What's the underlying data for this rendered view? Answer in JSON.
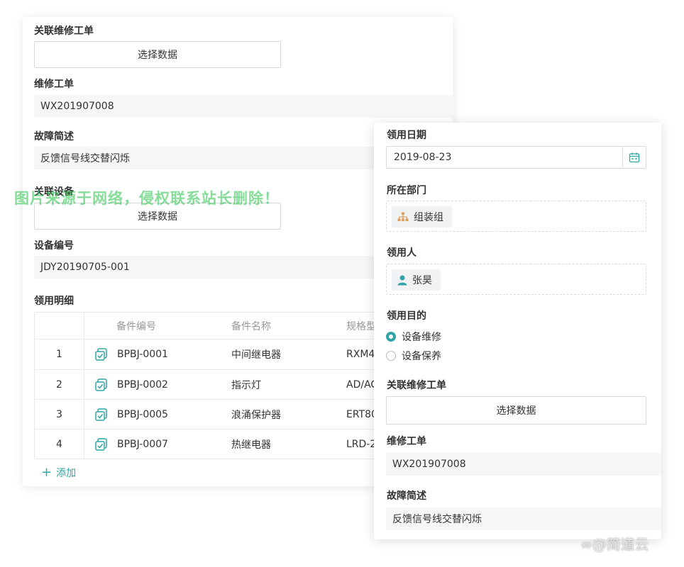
{
  "back_form": {
    "related_work_order_label": "关联维修工单",
    "select_data_label": "选择数据",
    "work_order_label": "维修工单",
    "work_order_value": "WX201907008",
    "fault_label": "故障简述",
    "fault_value": "反馈信号线交替闪烁",
    "related_device_label": "关联设备",
    "device_select_label": "选择数据",
    "device_no_label": "设备编号",
    "device_no_value": "JDY20190705-001",
    "detail_label": "领用明细",
    "table": {
      "headers": [
        "备件编号",
        "备件名称",
        "规格型"
      ],
      "rows": [
        {
          "index": "1",
          "code": "BPBJ-0001",
          "name": "中间继电器",
          "spec": "RXM4"
        },
        {
          "index": "2",
          "code": "BPBJ-0002",
          "name": "指示灯",
          "spec": "AD/AC"
        },
        {
          "index": "3",
          "code": "BPBJ-0005",
          "name": "浪涌保护器",
          "spec": "ERT80"
        },
        {
          "index": "4",
          "code": "BPBJ-0007",
          "name": "热继电器",
          "spec": "LRD-2"
        }
      ]
    },
    "add_label": "添加"
  },
  "front_form": {
    "date_label": "领用日期",
    "date_value": "2019-08-23",
    "dept_label": "所在部门",
    "dept_value": "组装组",
    "person_label": "领用人",
    "person_value": "张昊",
    "purpose_label": "领用目的",
    "purpose_options": [
      {
        "label": "设备维修",
        "checked": true
      },
      {
        "label": "设备保养",
        "checked": false
      }
    ],
    "related_work_order_label": "关联维修工单",
    "select_data_label": "选择数据",
    "work_order_label": "维修工单",
    "work_order_value": "WX201907008",
    "fault_label": "故障简述",
    "fault_value": "反馈信号线交替闪烁"
  },
  "watermark": "图片来源于网络，侵权联系站长删除！",
  "brand": "@简道云",
  "colors": {
    "accent": "#2fa5a5",
    "icon_org": "#d9a05b",
    "watermark": "#3cc85a"
  },
  "icons": [
    "part-icon",
    "calendar-icon",
    "org-icon",
    "user-icon",
    "plus-icon",
    "brand-logo-icon"
  ]
}
